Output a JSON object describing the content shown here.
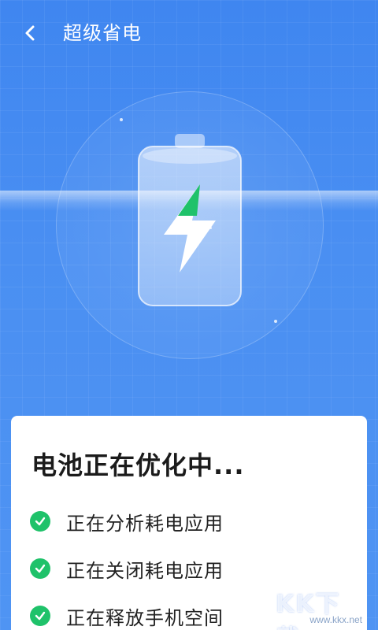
{
  "header": {
    "title": "超级省电",
    "back_icon": "chevron-left-icon"
  },
  "hero": {
    "icon": "battery-charging-icon",
    "battery_level": 0.25,
    "accent_green": "#1fc26a"
  },
  "card": {
    "title": "电池正在优化中...",
    "tasks": [
      {
        "label": "正在分析耗电应用",
        "status": "done"
      },
      {
        "label": "正在关闭耗电应用",
        "status": "done"
      },
      {
        "label": "正在释放手机空间",
        "status": "done"
      }
    ]
  },
  "watermark": {
    "main": "KK下载",
    "sub": "www.kkx.net"
  },
  "colors": {
    "background": "#4a8ff2",
    "check": "#1fc26a"
  }
}
